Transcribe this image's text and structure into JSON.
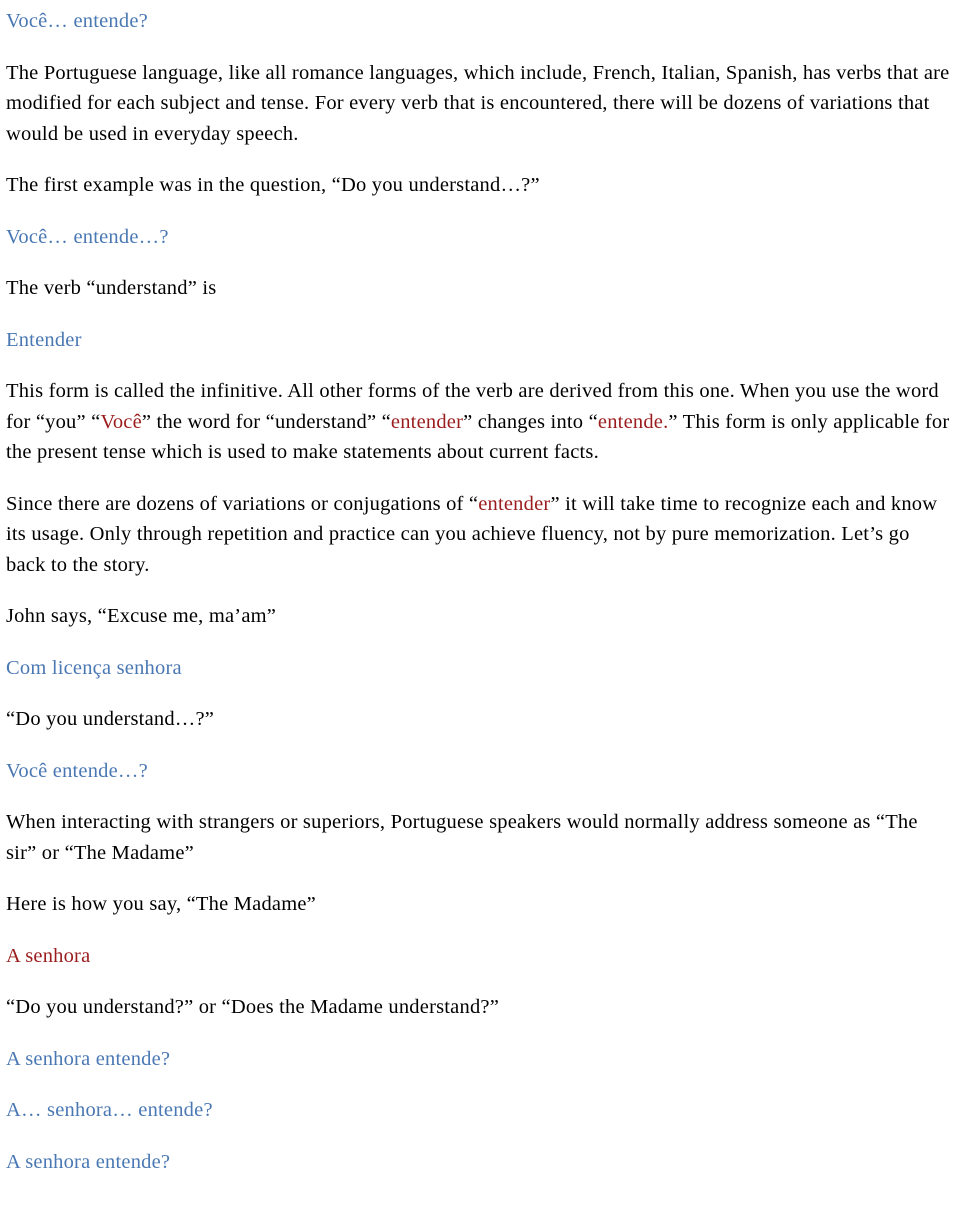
{
  "document": {
    "colors": {
      "portuguese_blue": "#4a78b3",
      "highlight_red": "#9b1c1c",
      "body_black": "#000000",
      "page_background": "#ffffff"
    },
    "blocks": [
      {
        "id": "heading-voce-entende",
        "kind": "portuguese-heading",
        "text": "Você… entende?"
      },
      {
        "id": "para-portuguese-language",
        "kind": "body-paragraph",
        "text": "The Portuguese language, like all romance languages, which include, French, Italian, Spanish, has verbs that are modified for each subject and tense. For every verb that is encountered, there will be dozens of variations that would be used in everyday speech."
      },
      {
        "id": "para-first-example",
        "kind": "body-paragraph",
        "text": "The first example was in the question, “Do you understand…?”"
      },
      {
        "id": "line-voce-entende-2",
        "kind": "portuguese-line",
        "text": "Você… entende…?"
      },
      {
        "id": "line-verb-understand",
        "kind": "body-paragraph",
        "text": "The verb “understand” is"
      },
      {
        "id": "line-entender",
        "kind": "portuguese-line",
        "text": "Entender"
      },
      {
        "id": "para-infinitive",
        "kind": "rich-paragraph",
        "runs": [
          {
            "text": "This form is called the infinitive. All other forms of the verb are derived from this one. When you use the word for “you” “",
            "color": "black"
          },
          {
            "text": "Você",
            "color": "red"
          },
          {
            "text": "” the word for “understand” “",
            "color": "black"
          },
          {
            "text": "entender",
            "color": "red"
          },
          {
            "text": "” changes into “",
            "color": "black"
          },
          {
            "text": "entende.",
            "color": "red"
          },
          {
            "text": "” This form is only applicable for the present tense which is used to make statements about current facts.",
            "color": "black"
          }
        ]
      },
      {
        "id": "para-dozens-variations",
        "kind": "rich-paragraph",
        "runs": [
          {
            "text": "Since there are dozens of variations or conjugations of “",
            "color": "black"
          },
          {
            "text": "entender",
            "color": "red"
          },
          {
            "text": "” it will take time to recognize each and know its usage. Only through repetition and practice can you achieve fluency, not by pure memorization. Let’s go back to the story.",
            "color": "black"
          }
        ]
      },
      {
        "id": "line-john-says",
        "kind": "body-paragraph",
        "text": "John says, “Excuse me, ma’am”"
      },
      {
        "id": "line-com-licenca",
        "kind": "portuguese-line",
        "text": "Com licença senhora"
      },
      {
        "id": "line-do-you-understand",
        "kind": "body-paragraph",
        "text": "“Do you understand…?”"
      },
      {
        "id": "line-voce-entende-3",
        "kind": "portuguese-line",
        "text": "Você entende…?"
      },
      {
        "id": "para-strangers-superiors",
        "kind": "body-paragraph",
        "text": "When interacting with strangers or superiors, Portuguese speakers would normally address someone as “The sir” or “The Madame”"
      },
      {
        "id": "line-here-is-how",
        "kind": "body-paragraph",
        "text": "Here is how you say, “The Madame”"
      },
      {
        "id": "line-a-senhora-red",
        "kind": "highlight-line",
        "text": "A senhora"
      },
      {
        "id": "line-do-you-understand-madame",
        "kind": "body-paragraph",
        "text": "“Do you understand?” or “Does the Madame understand?”"
      },
      {
        "id": "line-a-senhora-entende-1",
        "kind": "portuguese-line",
        "text": "A senhora entende?"
      },
      {
        "id": "line-a-senhora-entende-2",
        "kind": "portuguese-line",
        "text": "A… senhora… entende?"
      },
      {
        "id": "line-a-senhora-entende-3",
        "kind": "portuguese-line",
        "text": "A senhora entende?"
      }
    ]
  }
}
